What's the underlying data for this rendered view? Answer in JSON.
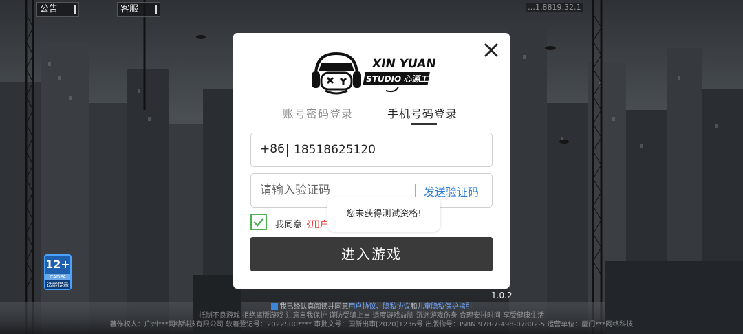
{
  "top_bar": {
    "notice_label": "公告",
    "service_label": "客服",
    "version_notice": "…1.8819.32.1"
  },
  "login_modal": {
    "tabs": [
      {
        "label": "账号密码登录",
        "active": false
      },
      {
        "label": "手机号码登录",
        "active": true
      }
    ],
    "phone": {
      "country_code": "+86",
      "value": "18518625120"
    },
    "code": {
      "placeholder": "请输入验证码",
      "send_label": "发送验证码"
    },
    "agreement": {
      "prefix": "我同意",
      "link": "《用户"
    },
    "enter_button": "进入游戏"
  },
  "toast": {
    "message": "您未获得测试资格!"
  },
  "age_rating": {
    "age": "12+",
    "org": "CADPA",
    "tip": "适龄提示"
  },
  "app_version": "1.0.2",
  "footer": {
    "agree_prefix": "我已经认真阅读并同意",
    "agree_links": "用户协议、隐私协议",
    "agree_and": "和",
    "agree_children": "儿童隐私保护指引",
    "line2": "抵制不良游戏  拒绝盗版游戏  注意自我保护  谨防受骗上当  适度游戏益脑  沉迷游戏伤身  合理安排时间  享受健康生活",
    "line3": "著作权人：广州***网络科技有限公司  软著登记号：2022SR0****  审批文号：国新出审[2020]1236号  出版物号：ISBN 978-7-498-07802-5  运营单位：厦门***网络科技"
  },
  "colors": {
    "accent_link": "#2f7fd9",
    "agree_link": "#e53935",
    "check": "#4caf50",
    "button": "#3a3a3a"
  }
}
